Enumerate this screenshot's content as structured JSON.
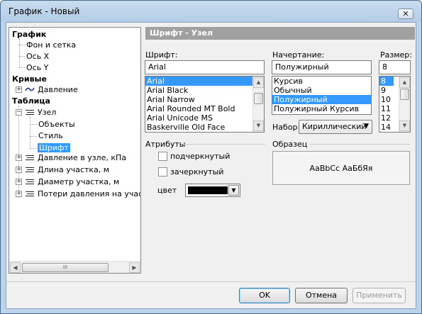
{
  "window": {
    "title": "График - Новый",
    "close_glyph": "✕"
  },
  "tree": {
    "graph": "График",
    "background": "Фон и сетка",
    "axis_x": "Ось X",
    "axis_y": "Ось Y",
    "curves": "Кривые",
    "pressure": "Давление",
    "table": "Таблица",
    "node": "Узел",
    "objects": "Объекты",
    "style": "Стиль",
    "font": "Шрифт",
    "node_pressure": "Давление в узле, кПа",
    "segment_length": "Длина участка, м",
    "diameter": "Диаметр участка, м",
    "pressure_loss": "Потери давления на участк",
    "scroll_thumb_glyph": "III"
  },
  "panel": {
    "header": "Шрифт - Узел",
    "font_label": "Шрифт:",
    "font_value": "Arial",
    "fonts": [
      "Arial",
      "Arial Black",
      "Arial Narrow",
      "Arial Rounded MT Bold",
      "Arial Unicode MS",
      "Baskerville Old Face"
    ],
    "style_label": "Начертание:",
    "style_value": "Полужирный",
    "styles": [
      "Курсив",
      "Обычный",
      "Полужирный",
      "Полужирный Курсив"
    ],
    "size_label": "Размер:",
    "size_value": "8",
    "sizes": [
      "8",
      "9",
      "10",
      "11",
      "12",
      "14"
    ],
    "charset_label": "Набор:",
    "charset_value": "Кириллический",
    "attributes_label": "Атрибуты",
    "underline_label": "подчеркнутый",
    "strike_label": "зачеркнутый",
    "color_label": "цвет",
    "color_value": "#000000",
    "sample_label": "Образец",
    "sample_text": "AaBbCc AaБбЯя"
  },
  "buttons": {
    "ok": "OK",
    "cancel": "Отмена",
    "apply": "Применить"
  }
}
